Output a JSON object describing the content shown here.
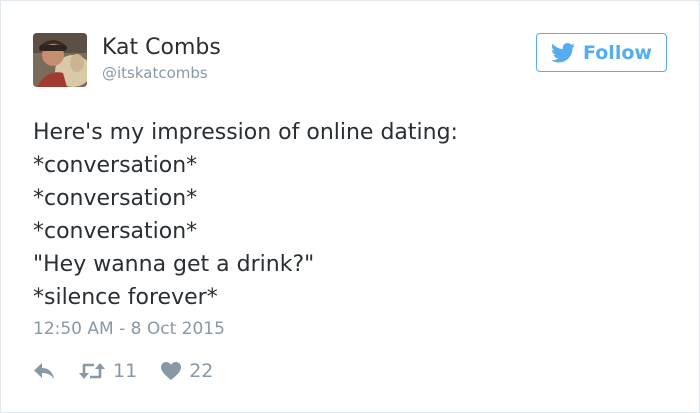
{
  "user": {
    "name": "Kat Combs",
    "handle": "@itskatcombs"
  },
  "follow_button": {
    "label": "Follow",
    "icon": "twitter-bird-icon",
    "color": "#55acee"
  },
  "tweet": {
    "lines": [
      "Here's my impression of online dating:",
      "*conversation*",
      "*conversation*",
      "*conversation*",
      "\"Hey wanna get a drink?\"",
      "*silence forever*"
    ],
    "timestamp": "12:50 AM - 8 Oct 2015"
  },
  "actions": {
    "reply": {
      "icon": "reply-icon"
    },
    "retweet": {
      "icon": "retweet-icon",
      "count": "11"
    },
    "like": {
      "icon": "heart-icon",
      "count": "22"
    }
  },
  "colors": {
    "text": "#292f33",
    "muted": "#8899a6",
    "accent": "#55acee",
    "border": "#e1e8ed"
  }
}
